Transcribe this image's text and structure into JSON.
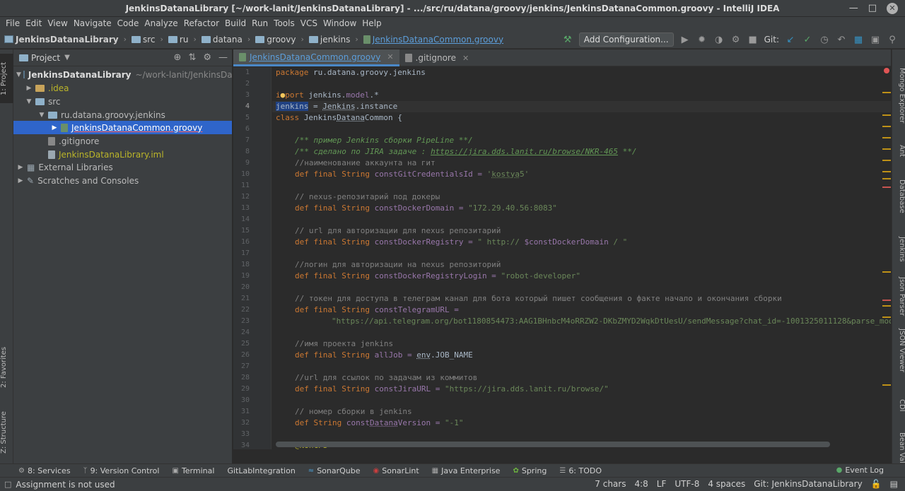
{
  "window": {
    "title": "JenkinsDatanaLibrary [~/work-lanit/JenkinsDatanaLibrary] - .../src/ru/datana/groovy/jenkins/JenkinsDatanaCommon.groovy - IntelliJ IDEA"
  },
  "menu": [
    "File",
    "Edit",
    "View",
    "Navigate",
    "Code",
    "Analyze",
    "Refactor",
    "Build",
    "Run",
    "Tools",
    "VCS",
    "Window",
    "Help"
  ],
  "breadcrumbs": [
    "JenkinsDatanaLibrary",
    "src",
    "ru",
    "datana",
    "groovy",
    "jenkins",
    "JenkinsDatanaCommon.groovy"
  ],
  "toolbar": {
    "add_configuration": "Add Configuration...",
    "git_label": "Git:"
  },
  "left_tabs": [
    "1: Project",
    "2: Favorites",
    "Z: Structure"
  ],
  "project_panel": {
    "title": "Project",
    "tree": [
      {
        "label": "JenkinsDatanaLibrary",
        "extra": "~/work-lanit/JenkinsDatanaLibrary"
      },
      {
        "label": ".idea"
      },
      {
        "label": "src"
      },
      {
        "label": "ru.datana.groovy.jenkins"
      },
      {
        "label": "JenkinsDatanaCommon.groovy"
      },
      {
        "label": ".gitignore"
      },
      {
        "label": "JenkinsDatanaLibrary.iml"
      },
      {
        "label": "External Libraries"
      },
      {
        "label": "Scratches and Consoles"
      }
    ]
  },
  "editor": {
    "tabs": [
      {
        "label": "JenkinsDatanaCommon.groovy"
      },
      {
        "label": ".gitignore"
      }
    ],
    "line_numbers": [
      "1",
      "2",
      "3",
      "4",
      "5",
      "6",
      "7",
      "8",
      "9",
      "10",
      "11",
      "12",
      "13",
      "14",
      "15",
      "16",
      "17",
      "18",
      "19",
      "20",
      "21",
      "22",
      "23",
      "24",
      "25",
      "26",
      "27",
      "28",
      "29",
      "30",
      "31",
      "32",
      "33",
      "34"
    ]
  },
  "code": {
    "l1_kw": "package",
    "l1_rest": " ru.datana.groovy.jenkins",
    "l3_kw_a": "i",
    "l3_kw_b": "port",
    "l3_a": " jenkins.",
    "l3_field": "model",
    "l3_b": ".*",
    "l4_id": "jenkins",
    "l4_a": " = ",
    "l4_class": "Jenkins",
    "l4_b": ".instance",
    "l5_kw": "class",
    "l5_a": " Jenkins",
    "l5_b": "Datana",
    "l5_c": "Common {",
    "l7": "/** пример Jenkins сборки PipeLine **/",
    "l8_a": "/** сделано по JIRA задаче : ",
    "l8_link": "https://jira.dds.lanit.ru/browse/NKR-465",
    "l8_b": " **/",
    "l9": "//наименование аккаунта на гит",
    "def": "def",
    "final": "final",
    "String": "String",
    "l10_name": " constGitCredentialsId = ",
    "l10_val_a": "'",
    "l10_val_b": "kostya",
    "l10_val_c": "5'",
    "l12": "// nexus-репозитарий под докеры",
    "l13_name": " constDockerDomain = ",
    "l13_val": "\"172.29.40.56:8083\"",
    "l15": "// url для авторизации для nexus репозитарий",
    "l16_name": " constDockerRegistry = ",
    "l16_val_a": "\" http:// ",
    "l16_val_b": "$constDockerDomain",
    "l16_val_c": " / \"",
    "l18": "//логин для авторизации на nexus репозиторий",
    "l19_name": " constDockerRegistryLogin = ",
    "l19_val": "\"robot-developer\"",
    "l21": "// токен для доступа в телеграм канал для бота который пишет сообщения о факте начало и окончания сборки",
    "l22_name": " constTelegramURL =",
    "l23_val": "\"https://api.telegram.org/bot1180854473:AAG1BHnbcM4oRRZW2-DKbZMYD2WqkDtUesU/sendMessage?chat_id=-1001325011128&parse_mode",
    "l25": "//имя проекта jenkins",
    "l26_name": " allJob = ",
    "l26_env": "env",
    "l26_rest": ".JOB_NAME",
    "l28": "//url для ссылок по задачам из коммитов",
    "l29_name": " constJiraURL = ",
    "l29_val": "\"https://jira.dds.lanit.ru/browse/\"",
    "l31": "// номер сборки в jenkins",
    "l32_name_a": " const",
    "l32_name_b": "Datana",
    "l32_name_c": "Version = ",
    "l32_val": "\"-1\"",
    "l34": "@NonCPS"
  },
  "right_tabs": [
    "Mongo Explorer",
    "Ant",
    "Database",
    "Jenkins",
    "Json Parser",
    "JSON Viewer",
    "CDI",
    "Bean Val"
  ],
  "bottom_tools": [
    {
      "label": "8: Services"
    },
    {
      "label": "9: Version Control"
    },
    {
      "label": "Terminal"
    },
    {
      "label": "GitLabIntegration"
    },
    {
      "label": "SonarQube"
    },
    {
      "label": "SonarLint"
    },
    {
      "label": "Java Enterprise"
    },
    {
      "label": "Spring"
    },
    {
      "label": "6: TODO"
    }
  ],
  "event_log": "Event Log",
  "status": {
    "message": "Assignment is not used",
    "chars": "7 chars",
    "position": "4:8",
    "line_sep": "LF",
    "encoding": "UTF-8",
    "indent": "4 spaces",
    "branch": "Git: JenkinsDatanaLibrary"
  },
  "colors": {
    "accent": "#2f65ca",
    "keyword": "#cc7832",
    "string": "#6a8759",
    "comment": "#808080",
    "doc_comment": "#629755",
    "field": "#9876aa"
  }
}
